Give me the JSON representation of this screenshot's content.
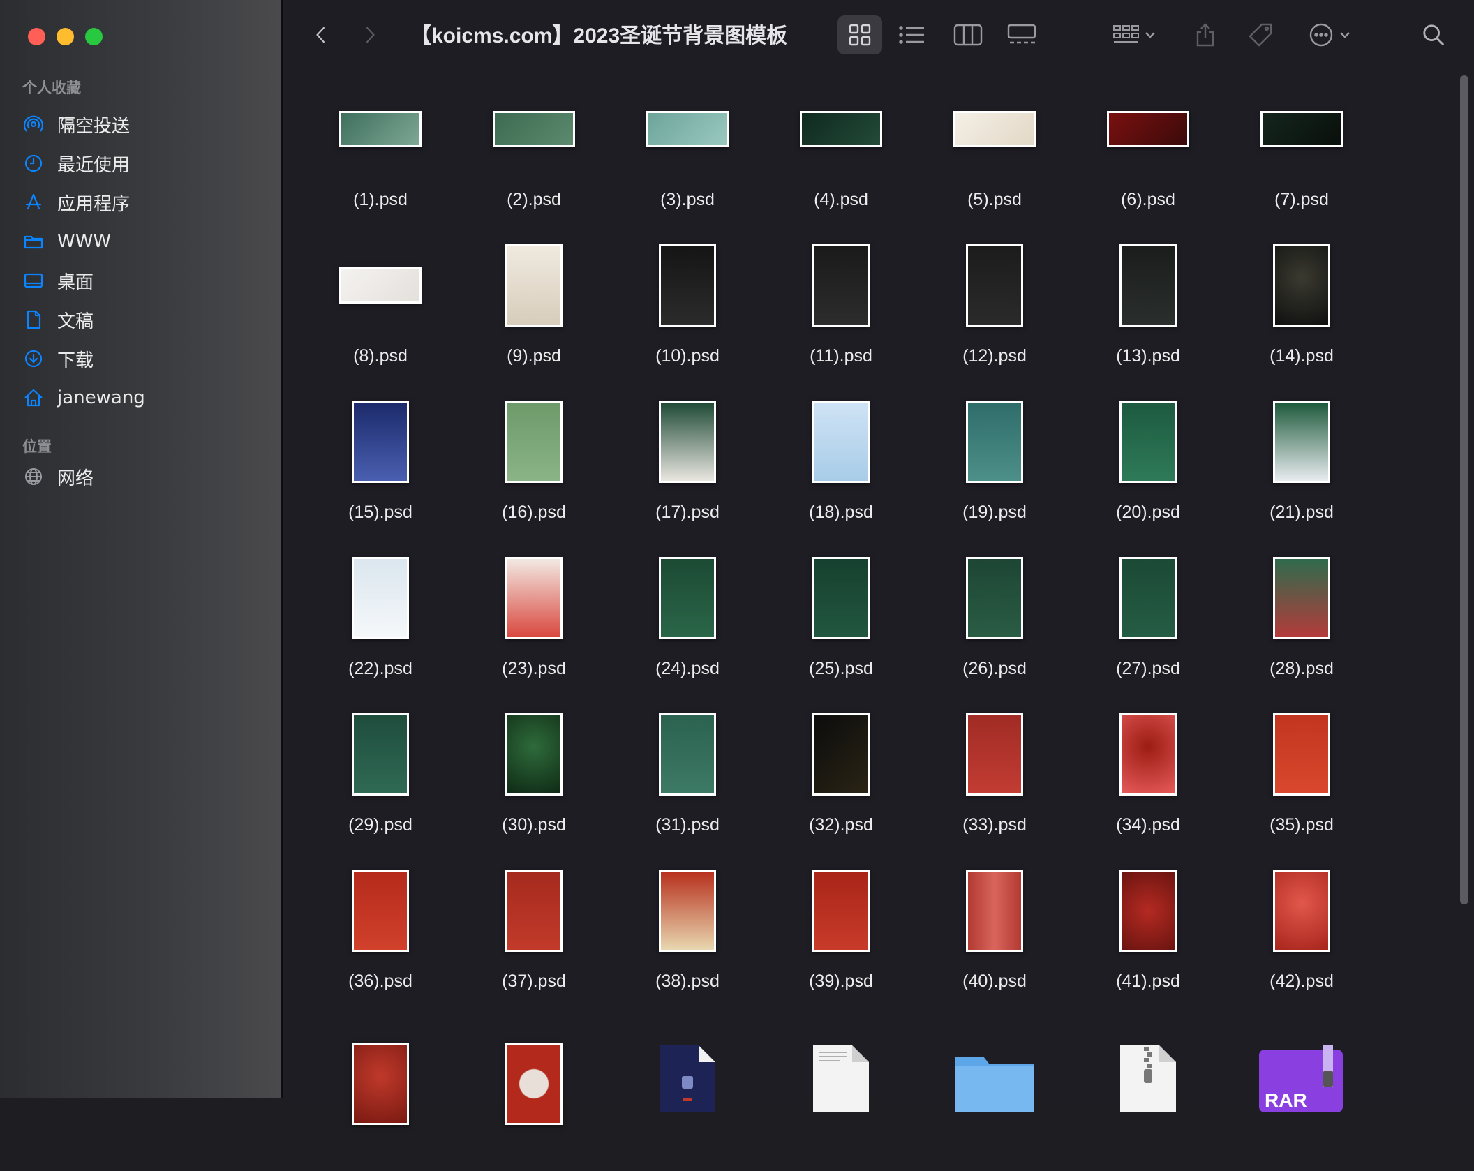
{
  "window": {
    "title": "【koicms.com】2023圣诞节背景图模板"
  },
  "sidebar": {
    "favorites_title": "个人收藏",
    "items": [
      {
        "label": "隔空投送",
        "icon": "airdrop-icon"
      },
      {
        "label": "最近使用",
        "icon": "clock-icon"
      },
      {
        "label": "应用程序",
        "icon": "applications-icon"
      },
      {
        "label": "WWW",
        "icon": "folder-icon"
      },
      {
        "label": "桌面",
        "icon": "desktop-icon"
      },
      {
        "label": "文稿",
        "icon": "document-icon"
      },
      {
        "label": "下载",
        "icon": "download-icon"
      },
      {
        "label": "janewang",
        "icon": "home-icon"
      }
    ],
    "locations_title": "位置",
    "locations": [
      {
        "label": "网络",
        "icon": "globe-icon"
      }
    ]
  },
  "colors": {
    "accent": "#0a84ff",
    "window_bg": "#1e1d24",
    "text": "#ececec"
  },
  "files": [
    {
      "name": "(1).psd",
      "shape": "land",
      "bg": "linear-gradient(135deg,#3f6f5d,#7fa896)"
    },
    {
      "name": "(2).psd",
      "shape": "land",
      "bg": "linear-gradient(135deg,#3d6b52,#5c8a6e)"
    },
    {
      "name": "(3).psd",
      "shape": "land",
      "bg": "linear-gradient(135deg,#6da59b,#9ac8bf)"
    },
    {
      "name": "(4).psd",
      "shape": "land",
      "bg": "linear-gradient(135deg,#0f2a20,#234a38)"
    },
    {
      "name": "(5).psd",
      "shape": "land",
      "bg": "linear-gradient(135deg,#f4efe6,#e2d8c6)"
    },
    {
      "name": "(6).psd",
      "shape": "land",
      "bg": "linear-gradient(135deg,#7a1010,#3b0a0a)"
    },
    {
      "name": "(7).psd",
      "shape": "land",
      "bg": "linear-gradient(135deg,#13261d,#0a0f0c)"
    },
    {
      "name": "(8).psd",
      "shape": "land",
      "bg": "linear-gradient(135deg,#f4f2f0,#e4e0dc)"
    },
    {
      "name": "(9).psd",
      "shape": "port",
      "bg": "linear-gradient(180deg,#efe9df,#d8cdbb)"
    },
    {
      "name": "(10).psd",
      "shape": "port",
      "bg": "linear-gradient(180deg,#151515,#2b2b2b)"
    },
    {
      "name": "(11).psd",
      "shape": "port",
      "bg": "linear-gradient(180deg,#1a1a1a,#2c2c2c)"
    },
    {
      "name": "(12).psd",
      "shape": "port",
      "bg": "linear-gradient(180deg,#1c1c1c,#2a2a2a)"
    },
    {
      "name": "(13).psd",
      "shape": "port",
      "bg": "linear-gradient(180deg,#1a1d1b,#2a2e2c)"
    },
    {
      "name": "(14).psd",
      "shape": "port",
      "bg": "radial-gradient(circle at 50% 40%,#3a3a30,#101010)"
    },
    {
      "name": "(15).psd",
      "shape": "port",
      "bg": "linear-gradient(180deg,#1b2a6b,#4a5fb0)"
    },
    {
      "name": "(16).psd",
      "shape": "port",
      "bg": "linear-gradient(180deg,#6e9a6a,#8ab486)"
    },
    {
      "name": "(17).psd",
      "shape": "port",
      "bg": "linear-gradient(180deg,#1f4a36,#e9e6e0)"
    },
    {
      "name": "(18).psd",
      "shape": "port",
      "bg": "linear-gradient(180deg,#cfe3f5,#a8cce8)"
    },
    {
      "name": "(19).psd",
      "shape": "port",
      "bg": "linear-gradient(180deg,#2f6d6a,#4d8f89)"
    },
    {
      "name": "(20).psd",
      "shape": "port",
      "bg": "linear-gradient(180deg,#1d5a40,#2e7a58)"
    },
    {
      "name": "(21).psd",
      "shape": "port",
      "bg": "linear-gradient(180deg,#1e5a3c,#e8ecef)"
    },
    {
      "name": "(22).psd",
      "shape": "port",
      "bg": "linear-gradient(180deg,#dbe6ee,#f5f8fa)"
    },
    {
      "name": "(23).psd",
      "shape": "port",
      "bg": "linear-gradient(180deg,#f2e9e3,#d9483e)"
    },
    {
      "name": "(24).psd",
      "shape": "port",
      "bg": "linear-gradient(180deg,#1c4a34,#2a6648)"
    },
    {
      "name": "(25).psd",
      "shape": "port",
      "bg": "linear-gradient(180deg,#16402f,#22573f)"
    },
    {
      "name": "(26).psd",
      "shape": "port",
      "bg": "linear-gradient(180deg,#1d4634,#2a5c44)"
    },
    {
      "name": "(27).psd",
      "shape": "port",
      "bg": "linear-gradient(180deg,#1b4a35,#255c44)"
    },
    {
      "name": "(28).psd",
      "shape": "port",
      "bg": "linear-gradient(180deg,#2e6b4c,#b43b3b)"
    },
    {
      "name": "(29).psd",
      "shape": "port",
      "bg": "linear-gradient(180deg,#1f4d3d,#2f6a55)"
    },
    {
      "name": "(30).psd",
      "shape": "port",
      "bg": "radial-gradient(circle at 50% 40%,#2e6b3a,#0f2a15)"
    },
    {
      "name": "(31).psd",
      "shape": "port",
      "bg": "linear-gradient(180deg,#2b6250,#3d7a66)"
    },
    {
      "name": "(32).psd",
      "shape": "port",
      "bg": "linear-gradient(135deg,#0c0c0c,#2a2415)"
    },
    {
      "name": "(33).psd",
      "shape": "port",
      "bg": "linear-gradient(180deg,#a02c25,#c23c33)"
    },
    {
      "name": "(34).psd",
      "shape": "port",
      "bg": "radial-gradient(circle at 50% 40%,#9b1c12,#e65a5a)"
    },
    {
      "name": "(35).psd",
      "shape": "port",
      "bg": "linear-gradient(180deg,#c2351f,#d9482e)"
    },
    {
      "name": "(36).psd",
      "shape": "port",
      "bg": "linear-gradient(180deg,#b52a1b,#d1412c)"
    },
    {
      "name": "(37).psd",
      "shape": "port",
      "bg": "linear-gradient(180deg,#a52a1e,#c23a2a)"
    },
    {
      "name": "(38).psd",
      "shape": "port",
      "bg": "linear-gradient(180deg,#b7301d,#e8d7b0)"
    },
    {
      "name": "(39).psd",
      "shape": "port",
      "bg": "linear-gradient(180deg,#a92518,#c83b2a)"
    },
    {
      "name": "(40).psd",
      "shape": "port",
      "bg": "linear-gradient(90deg,#b23a33,#d9655c,#b23a33)"
    },
    {
      "name": "(41).psd",
      "shape": "port",
      "bg": "radial-gradient(circle at 50% 50%,#b42a22,#6b1410)"
    },
    {
      "name": "(42).psd",
      "shape": "port",
      "bg": "radial-gradient(circle at 50% 40%,#e2574b,#a8261d)"
    }
  ],
  "bottom_row": [
    {
      "kind": "red-poster-1",
      "icon": "psd-thumbnail-icon"
    },
    {
      "kind": "red-poster-2",
      "icon": "psd-thumbnail-icon"
    },
    {
      "kind": "dark-doc",
      "icon": "document-icon"
    },
    {
      "kind": "text-doc",
      "icon": "text-document-icon"
    },
    {
      "kind": "folder",
      "icon": "folder-icon"
    },
    {
      "kind": "zip",
      "icon": "zip-archive-icon"
    },
    {
      "kind": "rar",
      "icon": "rar-archive-icon",
      "badge": "RAR"
    }
  ]
}
